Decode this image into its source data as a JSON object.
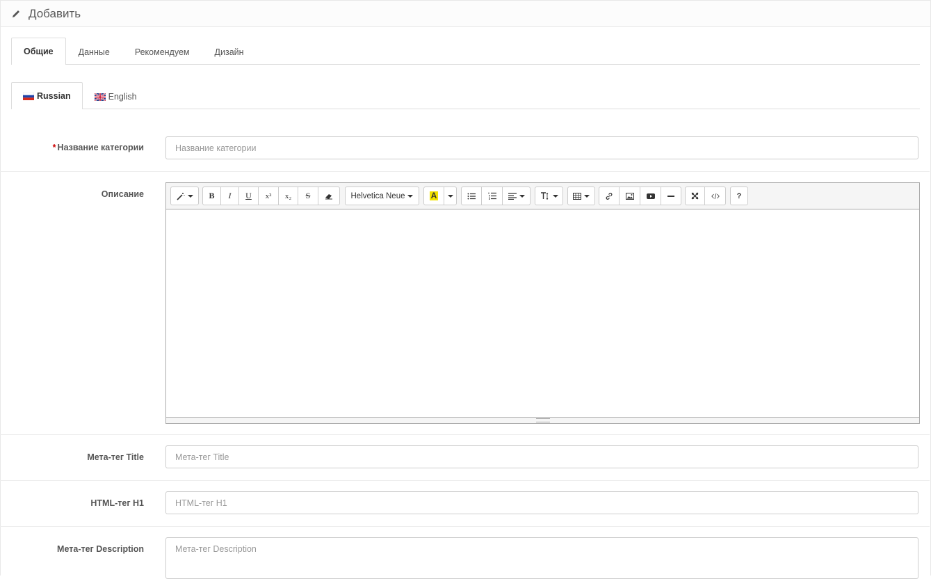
{
  "header": {
    "title": "Добавить",
    "icon": "pencil-icon"
  },
  "tabs": [
    {
      "label": "Общие",
      "active": true
    },
    {
      "label": "Данные",
      "active": false
    },
    {
      "label": "Рекомендуем",
      "active": false
    },
    {
      "label": "Дизайн",
      "active": false
    }
  ],
  "languages": [
    {
      "label": "Russian",
      "icon": "russia-flag-icon",
      "active": true
    },
    {
      "label": "English",
      "icon": "uk-flag-icon",
      "active": false
    }
  ],
  "form": {
    "category_name": {
      "label": "Название категории",
      "required": true,
      "value": "",
      "placeholder": "Название категории"
    },
    "description": {
      "label": "Описание"
    },
    "meta_title": {
      "label": "Мета-тег Title",
      "value": "",
      "placeholder": "Мета-тег Title"
    },
    "html_h1": {
      "label": "HTML-тег H1",
      "value": "",
      "placeholder": "HTML-тег H1"
    },
    "meta_description": {
      "label": "Мета-тег Description",
      "value": "",
      "placeholder": "Мета-тег Description"
    }
  },
  "editor": {
    "font_name": "Helvetica Neue",
    "toolbar": [
      "style-icon",
      "bold-icon",
      "italic-icon",
      "underline-icon",
      "superscript-icon",
      "subscript-icon",
      "strikethrough-icon",
      "eraser-icon",
      "font-name",
      "text-color-icon",
      "color-dropdown-icon",
      "unordered-list-icon",
      "ordered-list-icon",
      "paragraph-align-icon",
      "line-height-icon",
      "table-icon",
      "link-icon",
      "picture-icon",
      "video-icon",
      "horizontal-rule-icon",
      "fullscreen-icon",
      "code-view-icon",
      "help-icon"
    ],
    "glyphs": {
      "bold": "B",
      "italic": "I",
      "underline": "U",
      "superscript": "x²",
      "subscript": "x₂",
      "strikethrough": "S",
      "text_color": "A",
      "help": "?"
    },
    "accent": "#f2e200"
  },
  "colors": {
    "required": "#cc0000",
    "border": "#cccccc"
  }
}
